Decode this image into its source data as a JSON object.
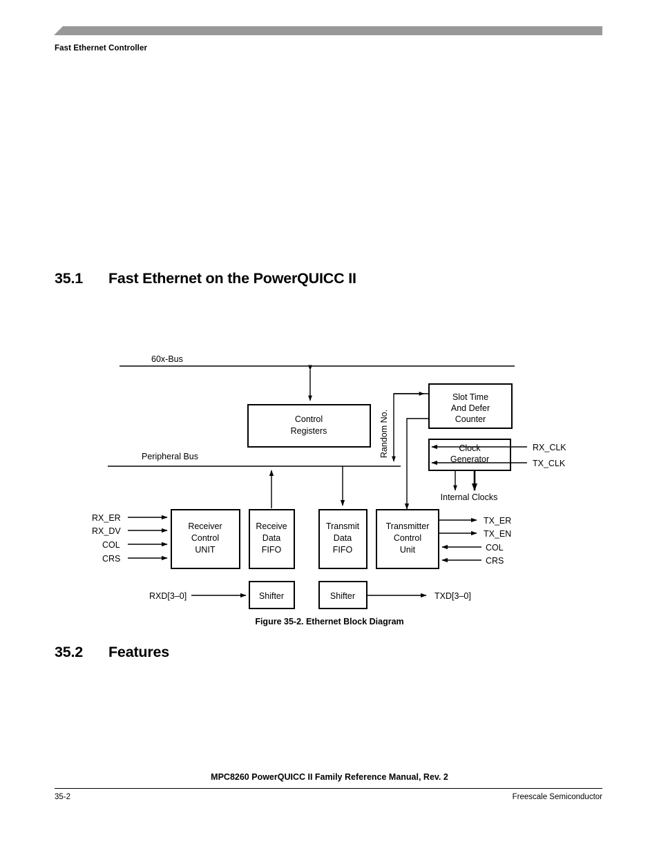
{
  "header": {
    "running_title": "Fast Ethernet Controller"
  },
  "sections": [
    {
      "number": "35.1",
      "title": "Fast Ethernet on the PowerQUICC II"
    },
    {
      "number": "35.2",
      "title": "Features"
    }
  ],
  "figure": {
    "caption": "Figure 35-2. Ethernet Block Diagram",
    "buses": {
      "top_bus_label": "60x-Bus",
      "peripheral_bus_label": "Peripheral Bus",
      "random_no_label": "Random No."
    },
    "blocks": {
      "control_registers": {
        "line1": "Control",
        "line2": "Registers"
      },
      "slot_time": {
        "line1": "Slot Time",
        "line2": "And Defer",
        "line3": "Counter"
      },
      "clock_generator": {
        "line1": "Clock",
        "line2": "Generator"
      },
      "receiver_control": {
        "line1": "Receiver",
        "line2": "Control",
        "line3": "UNIT"
      },
      "receive_fifo": {
        "line1": "Receive",
        "line2": "Data",
        "line3": "FIFO"
      },
      "transmit_fifo": {
        "line1": "Transmit",
        "line2": "Data",
        "line3": "FIFO"
      },
      "transmitter_control": {
        "line1": "Transmitter",
        "line2": "Control",
        "line3": "Unit"
      },
      "shifter_rx": {
        "line1": "Shifter"
      },
      "shifter_tx": {
        "line1": "Shifter"
      }
    },
    "signals": {
      "rx_clk": "RX_CLK",
      "tx_clk": "TX_CLK",
      "internal_clocks": "Internal Clocks",
      "rx_er": "RX_ER",
      "rx_dv": "RX_DV",
      "col_in": "COL",
      "crs_in": "CRS",
      "tx_er": "TX_ER",
      "tx_en": "TX_EN",
      "col_out": "COL",
      "crs_out": "CRS",
      "rxd": "RXD[3–0]",
      "txd": "TXD[3–0]"
    }
  },
  "footer": {
    "manual_title": "MPC8260 PowerQUICC II Family Reference Manual, Rev. 2",
    "page_number": "35-2",
    "company": "Freescale Semiconductor"
  },
  "colors": {
    "header_bar": "#989898",
    "ink": "#000000",
    "paper": "#ffffff"
  }
}
